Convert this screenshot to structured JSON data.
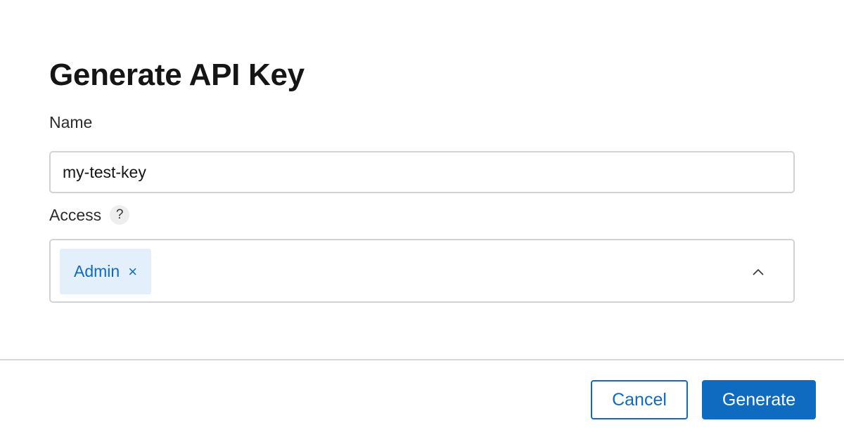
{
  "dialog": {
    "title": "Generate API Key"
  },
  "name_field": {
    "label": "Name",
    "value": "my-test-key"
  },
  "access_field": {
    "label": "Access",
    "help_icon": "question-mark-icon",
    "help_glyph": "?",
    "selected": [
      {
        "label": "Admin",
        "remove_glyph": "×"
      }
    ],
    "dropdown_icon": "chevron-up-icon"
  },
  "footer": {
    "cancel_label": "Cancel",
    "generate_label": "Generate"
  },
  "colors": {
    "accent": "#0f6bbf",
    "chip_background": "#e3effa",
    "border": "#d2d2d2"
  }
}
